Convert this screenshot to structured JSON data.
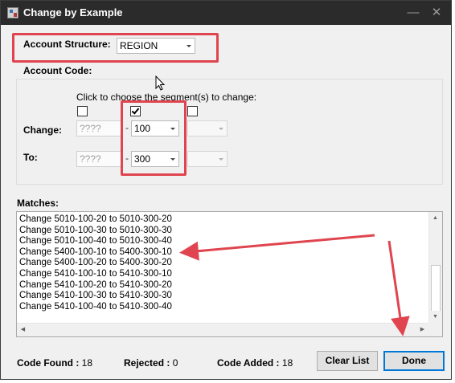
{
  "window": {
    "title": "Change by Example"
  },
  "titlebar": {
    "minimize_glyph": "—",
    "close_glyph": "✕"
  },
  "account_structure": {
    "label": "Account Structure:",
    "value": "REGION"
  },
  "account_code": {
    "label": "Account Code:",
    "instruction": "Click to choose the segment(s) to change:",
    "segments_checked": [
      false,
      true,
      false
    ],
    "change": {
      "label": "Change:",
      "seg1_placeholder": "????",
      "seg2_value": "100",
      "seg3_value": ""
    },
    "to": {
      "label": "To:",
      "seg1_placeholder": "????",
      "seg2_value": "300",
      "seg3_value": ""
    },
    "separator": "-"
  },
  "matches": {
    "label": "Matches:",
    "items": [
      "Change 5010-100-20 to 5010-300-20",
      "Change 5010-100-30 to 5010-300-30",
      "Change 5010-100-40 to 5010-300-40",
      "Change 5400-100-10 to 5400-300-10",
      "Change 5400-100-20 to 5400-300-20",
      "Change 5410-100-10 to 5410-300-10",
      "Change 5410-100-20 to 5410-300-20",
      "Change 5410-100-30 to 5410-300-30",
      "Change 5410-100-40 to 5410-300-40"
    ]
  },
  "status": {
    "code_found_label": "Code Found :",
    "code_found": "18",
    "rejected_label": "Rejected :",
    "rejected": "0",
    "code_added_label": "Code Added :",
    "code_added": "18"
  },
  "buttons": {
    "clear_list": "Clear List",
    "done": "Done"
  },
  "colors": {
    "annotation": "#e0454f",
    "default_button_border": "#0078d7",
    "titlebar": "#2b2b2b"
  },
  "icons": [
    "app-icon",
    "minimize-icon",
    "close-icon",
    "chevron-down-icon",
    "mouse-pointer-icon",
    "annotation-arrow-icon"
  ]
}
